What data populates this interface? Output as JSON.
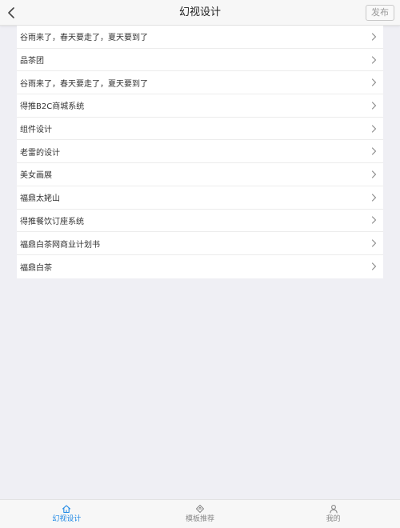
{
  "header": {
    "title": "幻视设计",
    "back_icon": "chevron-left-icon",
    "publish_label": "发布"
  },
  "list": {
    "items": [
      {
        "label": "谷雨来了，春天要走了，夏天要到了"
      },
      {
        "label": "品茶团"
      },
      {
        "label": "谷雨来了，春天要走了，夏天要到了"
      },
      {
        "label": "得推B2C商城系统"
      },
      {
        "label": "组件设计"
      },
      {
        "label": "老雷的设计"
      },
      {
        "label": "美女画展"
      },
      {
        "label": "福鼎太姥山"
      },
      {
        "label": "得推餐饮订座系统"
      },
      {
        "label": "福鼎白茶网商业计划书"
      },
      {
        "label": "福鼎白茶"
      }
    ],
    "row_icon": "chevron-right-icon"
  },
  "tabbar": {
    "tabs": [
      {
        "label": "幻视设计",
        "icon": "home-icon",
        "active": true
      },
      {
        "label": "模板推荐",
        "icon": "tag-icon",
        "active": false
      },
      {
        "label": "我的",
        "icon": "user-icon",
        "active": false
      }
    ]
  },
  "colors": {
    "background": "#efeff4",
    "accent": "#1e88e5",
    "text": "#333333",
    "muted": "#888888"
  }
}
